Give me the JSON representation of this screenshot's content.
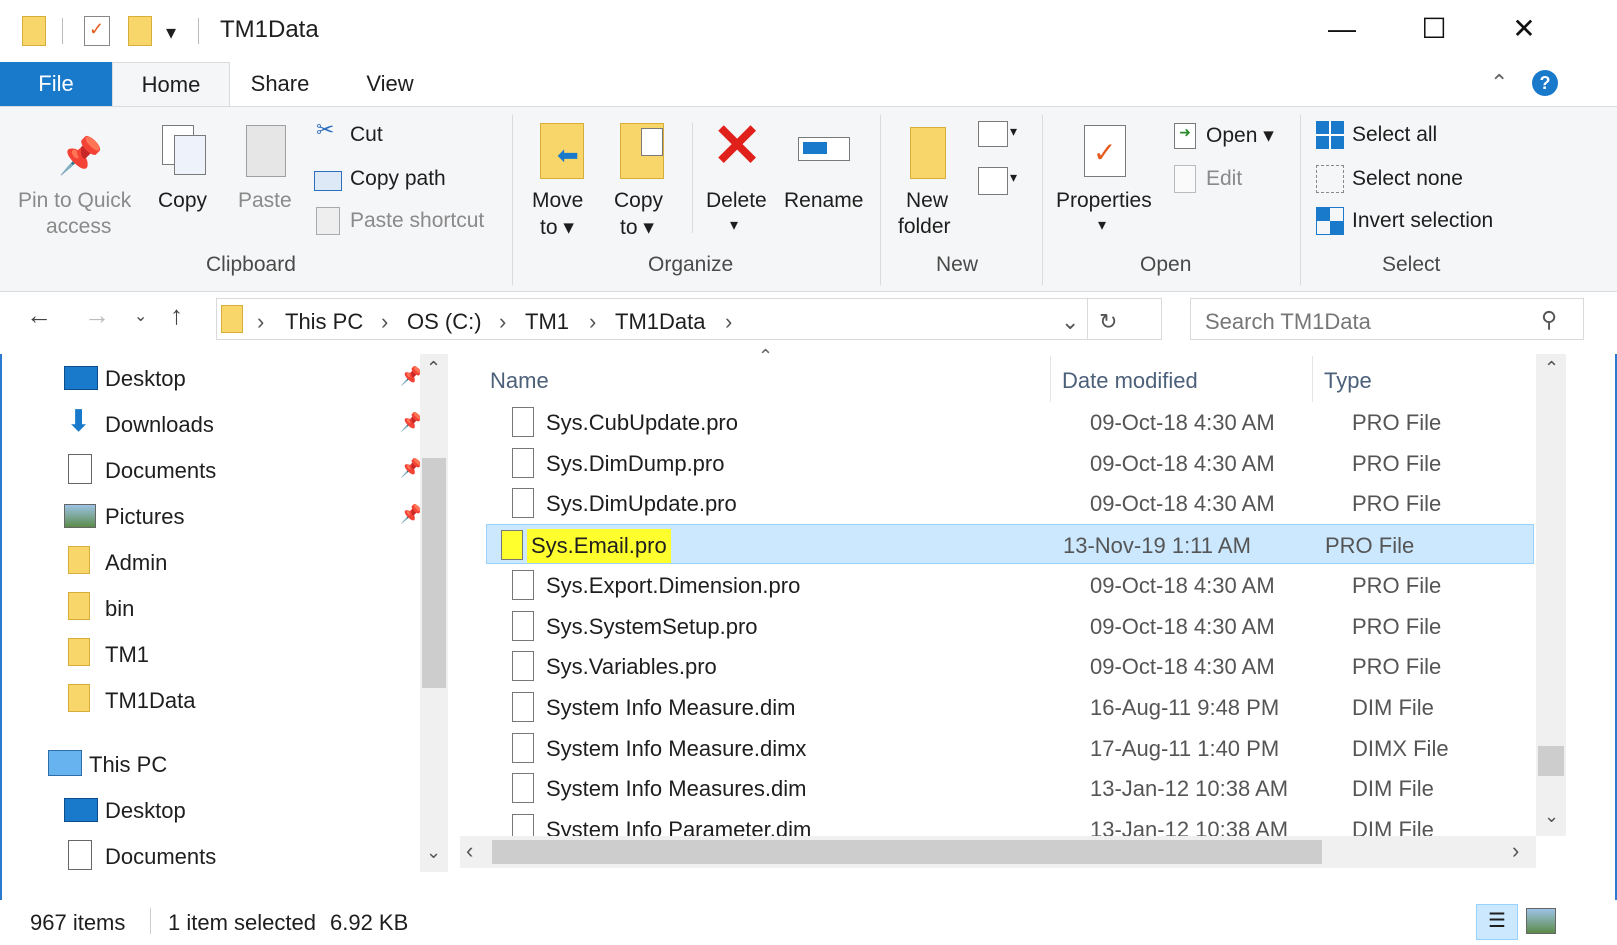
{
  "window": {
    "title": "TM1Data",
    "controls": [
      "—",
      "☐",
      "✕"
    ]
  },
  "tabs": [
    "File",
    "Home",
    "Share",
    "View"
  ],
  "ribbon": {
    "clipboard": {
      "label": "Clipboard",
      "pin_label_1": "Pin to Quick",
      "pin_label_2": "access",
      "copy": "Copy",
      "paste": "Paste",
      "cut": "Cut",
      "copy_path": "Copy path",
      "paste_shortcut": "Paste shortcut"
    },
    "organize": {
      "label": "Organize",
      "move_1": "Move",
      "move_2": "to ▾",
      "copy_1": "Copy",
      "copy_2": "to ▾",
      "delete": "Delete",
      "delete_arrow": "▾",
      "rename": "Rename"
    },
    "new": {
      "label": "New",
      "new_folder_1": "New",
      "new_folder_2": "folder"
    },
    "open": {
      "label": "Open",
      "properties": "Properties",
      "properties_arrow": "▾",
      "open": "Open ▾",
      "edit": "Edit"
    },
    "select": {
      "label": "Select",
      "select_all": "Select all",
      "select_none": "Select none",
      "invert": "Invert selection"
    }
  },
  "address": {
    "crumbs": [
      "This PC",
      "OS (C:)",
      "TM1",
      "TM1Data"
    ],
    "search_placeholder": "Search TM1Data"
  },
  "nav": {
    "quick_access": [
      {
        "label": "Desktop",
        "pinned": true
      },
      {
        "label": "Downloads",
        "pinned": true
      },
      {
        "label": "Documents",
        "pinned": true
      },
      {
        "label": "Pictures",
        "pinned": true
      },
      {
        "label": "Admin",
        "pinned": false
      },
      {
        "label": "bin",
        "pinned": false
      },
      {
        "label": "TM1",
        "pinned": false
      },
      {
        "label": "TM1Data",
        "pinned": false
      }
    ],
    "this_pc": "This PC",
    "this_pc_items": [
      "Desktop",
      "Documents"
    ]
  },
  "columns": {
    "name": "Name",
    "date": "Date modified",
    "type": "Type"
  },
  "files": [
    {
      "name": "Sys.CubUpdate.pro",
      "date": "09-Oct-18 4:30 AM",
      "type": "PRO File"
    },
    {
      "name": "Sys.DimDump.pro",
      "date": "09-Oct-18 4:30 AM",
      "type": "PRO File"
    },
    {
      "name": "Sys.DimUpdate.pro",
      "date": "09-Oct-18 4:30 AM",
      "type": "PRO File"
    },
    {
      "name": "Sys.Email.pro",
      "date": "13-Nov-19 1:11 AM",
      "type": "PRO File",
      "selected": true
    },
    {
      "name": "Sys.Export.Dimension.pro",
      "date": "09-Oct-18 4:30 AM",
      "type": "PRO File"
    },
    {
      "name": "Sys.SystemSetup.pro",
      "date": "09-Oct-18 4:30 AM",
      "type": "PRO File"
    },
    {
      "name": "Sys.Variables.pro",
      "date": "09-Oct-18 4:30 AM",
      "type": "PRO File"
    },
    {
      "name": "System Info Measure.dim",
      "date": "16-Aug-11 9:48 PM",
      "type": "DIM File"
    },
    {
      "name": "System Info Measure.dimx",
      "date": "17-Aug-11 1:40 PM",
      "type": "DIMX File"
    },
    {
      "name": "System Info Measures.dim",
      "date": "13-Jan-12 10:38 AM",
      "type": "DIM File"
    },
    {
      "name": "System Info Parameter.dim",
      "date": "13-Jan-12 10:38 AM",
      "type": "DIM File"
    }
  ],
  "status": {
    "count": "967 items",
    "selected": "1 item selected",
    "size": "6.92 KB"
  },
  "colors": {
    "accent": "#1979ca",
    "selection": "#cce8ff",
    "highlight": "#ffff2e"
  }
}
